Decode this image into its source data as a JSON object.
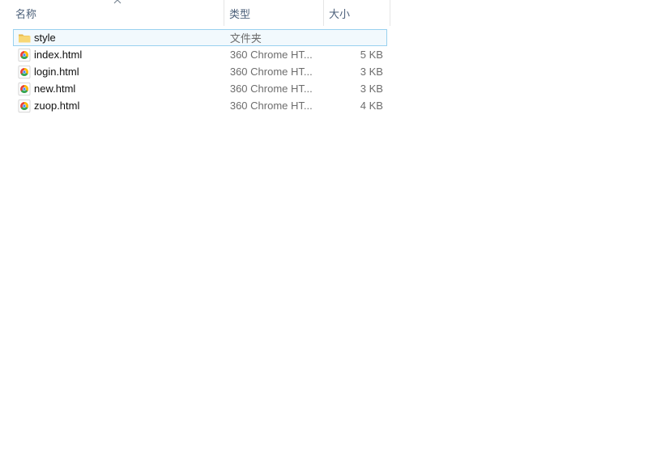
{
  "columns": {
    "name": "名称",
    "type": "类型",
    "size": "大小"
  },
  "sort": {
    "column": "name",
    "direction": "ascending",
    "icon": "chevron-up-icon"
  },
  "files": [
    {
      "name": "style",
      "type": "文件夹",
      "size": "",
      "icon": "folder-icon",
      "selected": true
    },
    {
      "name": "index.html",
      "type": "360 Chrome HT...",
      "size": "5 KB",
      "icon": "browser-html-icon",
      "selected": false
    },
    {
      "name": "login.html",
      "type": "360 Chrome HT...",
      "size": "3 KB",
      "icon": "browser-html-icon",
      "selected": false
    },
    {
      "name": "new.html",
      "type": "360 Chrome HT...",
      "size": "3 KB",
      "icon": "browser-html-icon",
      "selected": false
    },
    {
      "name": "zuop.html",
      "type": "360 Chrome HT...",
      "size": "4 KB",
      "icon": "browser-html-icon",
      "selected": false
    }
  ],
  "colors": {
    "selection_bg": "#f2f9fd",
    "selection_border": "#99d1ef",
    "header_text": "#4c607a",
    "folder_yellow": "#f8d775"
  }
}
